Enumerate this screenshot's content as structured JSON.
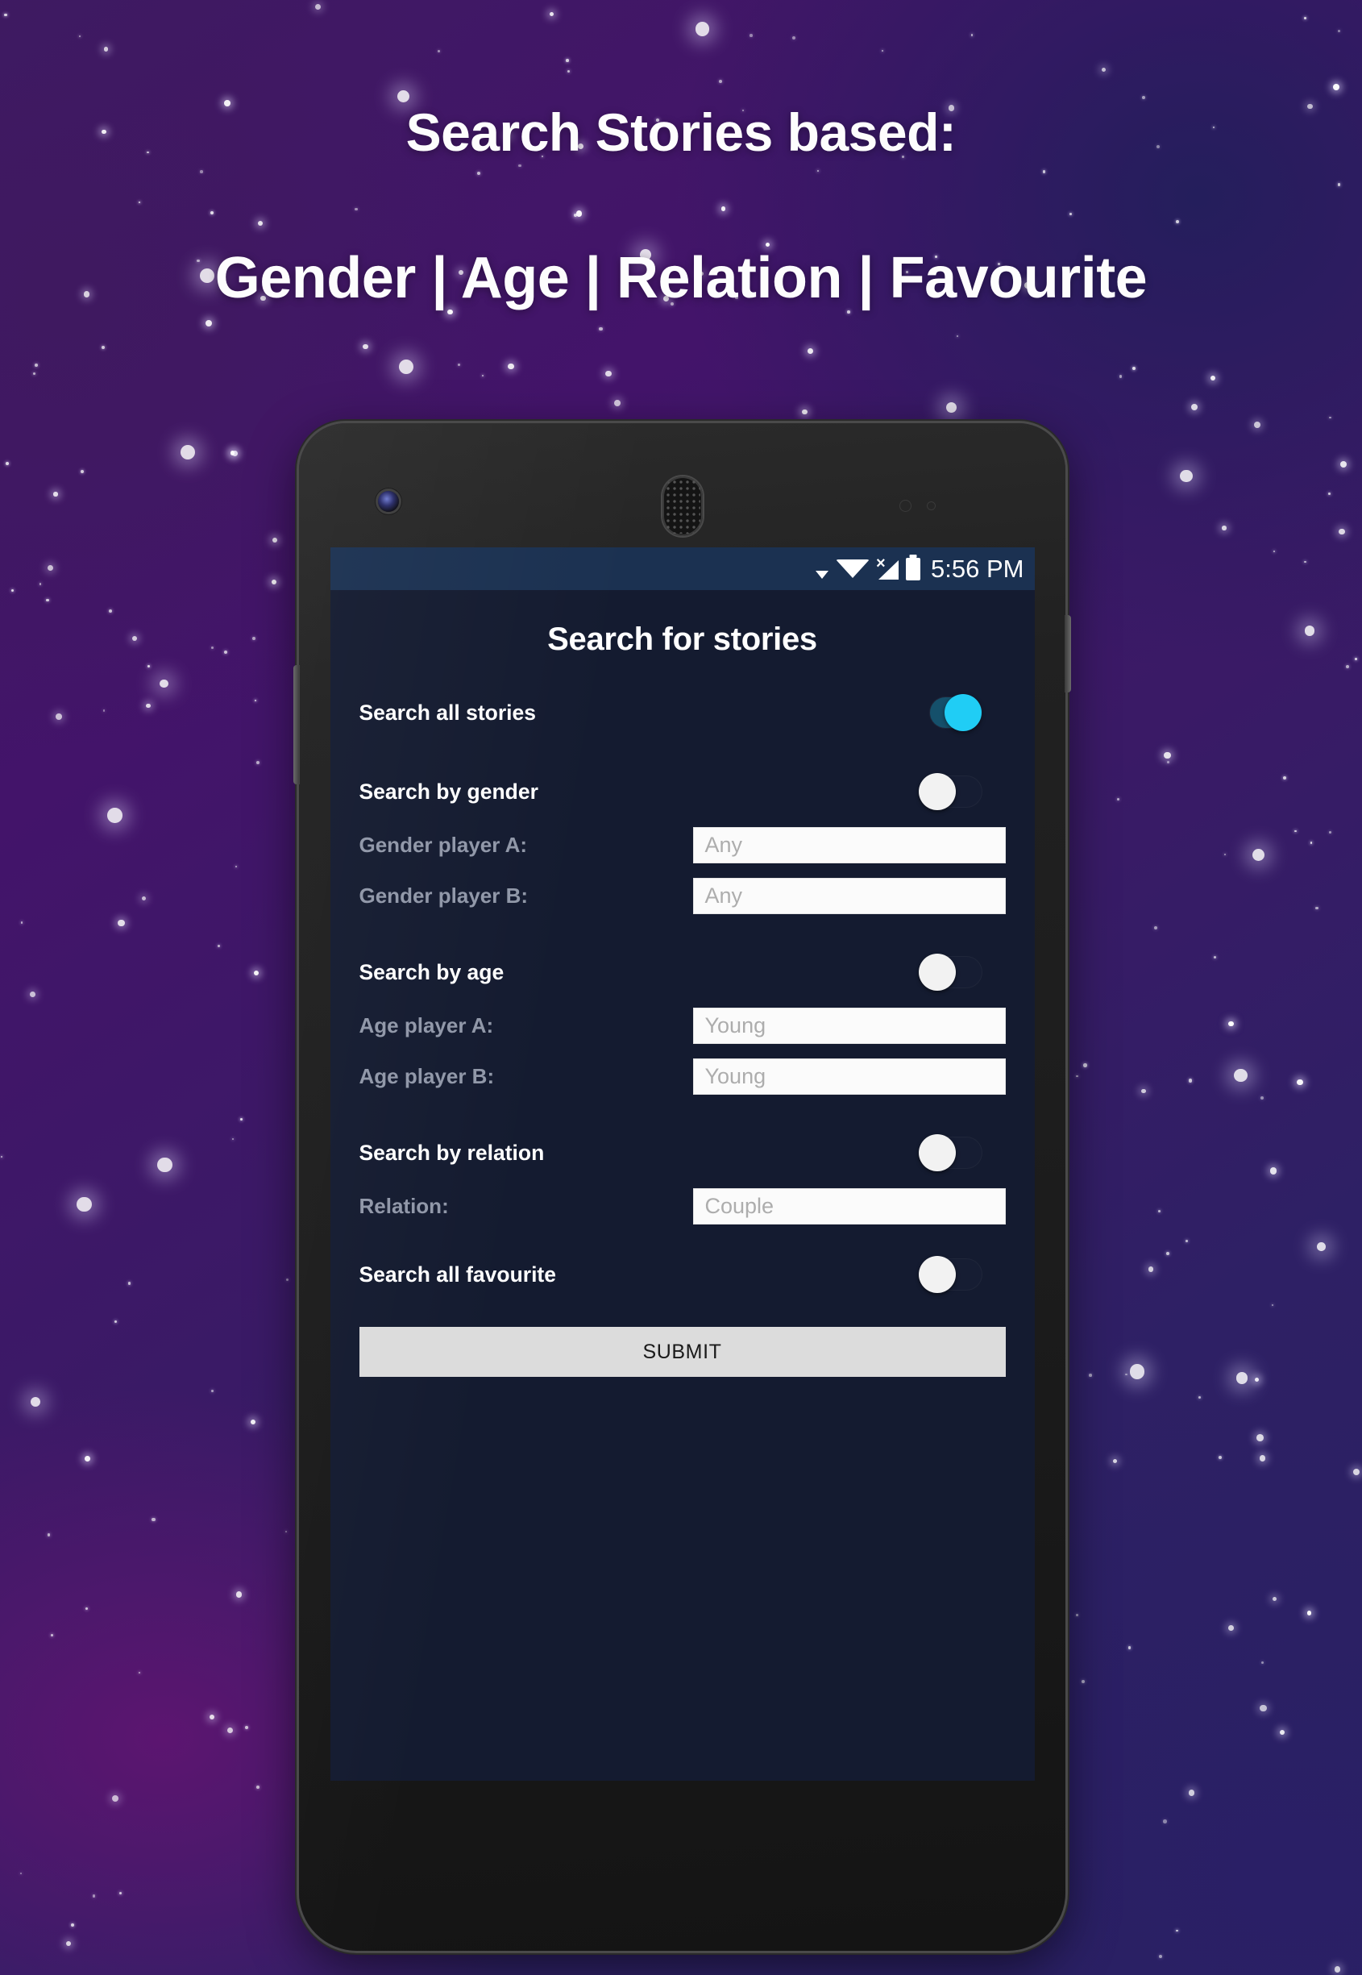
{
  "promo": {
    "headline_line1": "Search Stories based:",
    "headline_line2": "Gender | Age | Relation | Favourite",
    "background_color_top_left": "#3f1960",
    "background_color_top_right": "#2c2360",
    "background_color_bottom_left": "#4b1466"
  },
  "phone": {
    "device_style": "nexus-5",
    "frame_color": "#1c1c1c",
    "screen_background": "#141b30"
  },
  "status_bar": {
    "time": "5:56 PM",
    "background_color": "#1b3151",
    "icons": [
      "caret-down-icon",
      "wifi-icon",
      "no-signal-icon",
      "battery-full-icon"
    ]
  },
  "app": {
    "title": "Search for stories",
    "accent_color": "#20cdf5",
    "rows": [
      {
        "kind": "toggle",
        "label": "Search all stories",
        "state": "on"
      },
      {
        "kind": "toggle",
        "label": "Search by gender",
        "state": "off"
      },
      {
        "kind": "field",
        "label": "Gender player A:",
        "value": "Any"
      },
      {
        "kind": "field",
        "label": "Gender player B:",
        "value": "Any"
      },
      {
        "kind": "toggle",
        "label": "Search by age",
        "state": "off"
      },
      {
        "kind": "field",
        "label": "Age player A:",
        "value": "Young"
      },
      {
        "kind": "field",
        "label": "Age player B:",
        "value": "Young"
      },
      {
        "kind": "toggle",
        "label": "Search by relation",
        "state": "off"
      },
      {
        "kind": "field",
        "label": "Relation:",
        "value": "Couple"
      },
      {
        "kind": "toggle",
        "label": "Search all favourite",
        "state": "off"
      }
    ],
    "toggles": {
      "search_all_stories": "Search all stories",
      "search_by_gender": "Search by gender",
      "search_by_age": "Search by age",
      "search_by_relation": "Search by relation",
      "search_all_favourite": "Search all favourite"
    },
    "fields": {
      "gender_a_label": "Gender player A:",
      "gender_a_value": "Any",
      "gender_b_label": "Gender player B:",
      "gender_b_value": "Any",
      "age_a_label": "Age player A:",
      "age_a_value": "Young",
      "age_b_label": "Age player B:",
      "age_b_value": "Young",
      "relation_label": "Relation:",
      "relation_value": "Couple"
    },
    "submit_label": "SUBMIT"
  }
}
